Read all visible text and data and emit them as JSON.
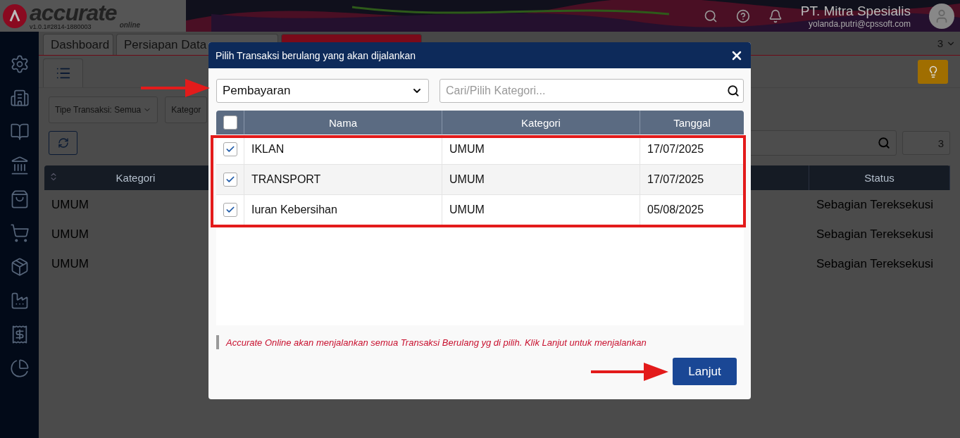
{
  "app": {
    "logo": "accurate",
    "logo_sub": "online",
    "version": "v1.0.1#2814-1880003",
    "company": "PT. Mitra Spesialis",
    "email": "yolanda.putri@cpssoft.com"
  },
  "tabs": [
    {
      "label": "Dashboard",
      "selected": false
    },
    {
      "label": "Persiapan Data",
      "selected": false
    },
    {
      "selected": true
    }
  ],
  "tab_count": "3",
  "filters": [
    "Tipe Transaksi: Semua",
    "Kategor"
  ],
  "page_field": "3",
  "table": {
    "columns": [
      "Kategori",
      "Status"
    ],
    "rows": [
      [
        "UMUM",
        "Sebagian Tereksekusi"
      ],
      [
        "UMUM",
        "Sebagian Tereksekusi"
      ],
      [
        "UMUM",
        "Sebagian Tereksekusi"
      ]
    ]
  },
  "dialog": {
    "title": "Pilih Transaksi berulang yang akan dijalankan",
    "type_select": "Pembayaran",
    "search": {
      "placeholder": "Cari/Pilih Kategori..."
    },
    "all_checked": false,
    "columns": [
      "Nama",
      "Kategori",
      "Tanggal"
    ],
    "rows": [
      {
        "checked": true,
        "cells": [
          "IKLAN",
          "UMUM",
          "17/07/2025"
        ]
      },
      {
        "checked": true,
        "cells": [
          "TRANSPORT",
          "UMUM",
          "17/07/2025"
        ]
      },
      {
        "checked": true,
        "cells": [
          "Iuran Kebersihan",
          "UMUM",
          "05/08/2025"
        ]
      }
    ],
    "note": "Accurate Online akan menjalankan semua Transaksi Berulang yg di pilih. Klik Lanjut untuk menjalankan",
    "button": "Lanjut"
  }
}
